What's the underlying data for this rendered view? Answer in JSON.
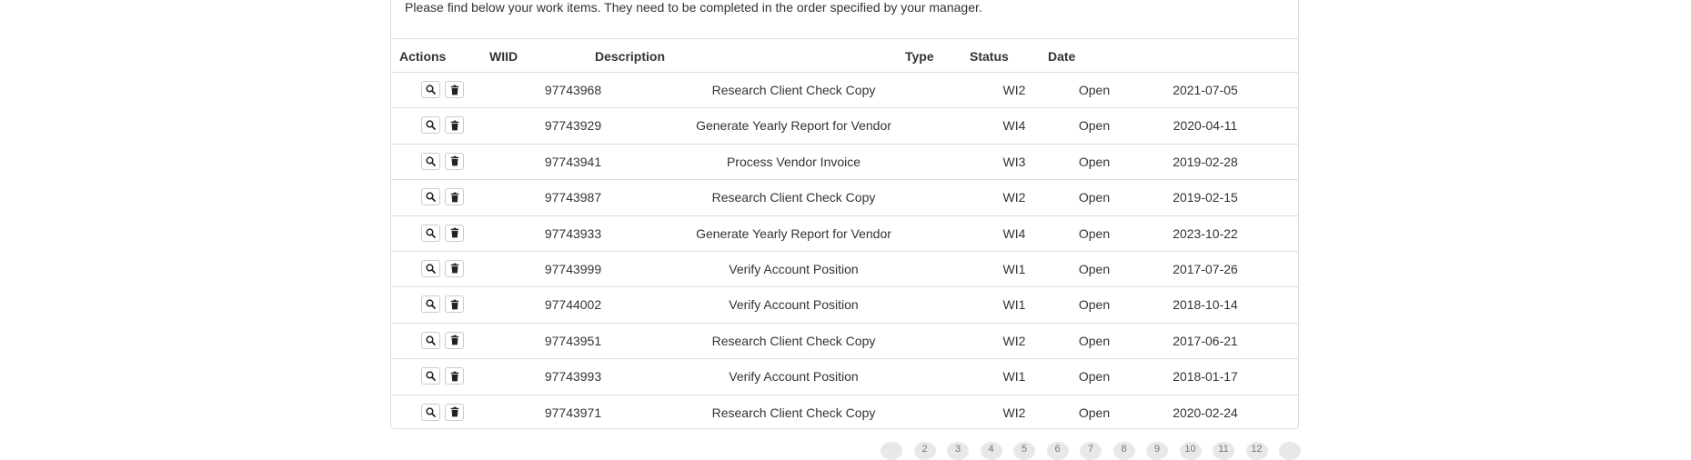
{
  "intro_text": "Please find below your work items. They need to be completed in the order specified by your manager.",
  "table": {
    "headers": {
      "actions": "Actions",
      "wiid": "WIID",
      "description": "Description",
      "type": "Type",
      "status": "Status",
      "date": "Date"
    },
    "rows": [
      {
        "wiid": "97743968",
        "description": "Research Client Check Copy",
        "type": "WI2",
        "status": "Open",
        "date": "2021-07-05"
      },
      {
        "wiid": "97743929",
        "description": "Generate Yearly Report for Vendor",
        "type": "WI4",
        "status": "Open",
        "date": "2020-04-11"
      },
      {
        "wiid": "97743941",
        "description": "Process Vendor Invoice",
        "type": "WI3",
        "status": "Open",
        "date": "2019-02-28"
      },
      {
        "wiid": "97743987",
        "description": "Research Client Check Copy",
        "type": "WI2",
        "status": "Open",
        "date": "2019-02-15"
      },
      {
        "wiid": "97743933",
        "description": "Generate Yearly Report for Vendor",
        "type": "WI4",
        "status": "Open",
        "date": "2023-10-22"
      },
      {
        "wiid": "97743999",
        "description": "Verify Account Position",
        "type": "WI1",
        "status": "Open",
        "date": "2017-07-26"
      },
      {
        "wiid": "97744002",
        "description": "Verify Account Position",
        "type": "WI1",
        "status": "Open",
        "date": "2018-10-14"
      },
      {
        "wiid": "97743951",
        "description": "Research Client Check Copy",
        "type": "WI2",
        "status": "Open",
        "date": "2017-06-21"
      },
      {
        "wiid": "97743993",
        "description": "Verify Account Position",
        "type": "WI1",
        "status": "Open",
        "date": "2018-01-17"
      },
      {
        "wiid": "97743971",
        "description": "Research Client Check Copy",
        "type": "WI2",
        "status": "Open",
        "date": "2020-02-24"
      }
    ]
  },
  "actions": {
    "view_icon": "search-icon",
    "delete_icon": "trash-icon"
  },
  "pagination": {
    "pages": [
      "",
      "2",
      "3",
      "4",
      "5",
      "6",
      "7",
      "8",
      "9",
      "10",
      "11",
      "12",
      ""
    ]
  }
}
